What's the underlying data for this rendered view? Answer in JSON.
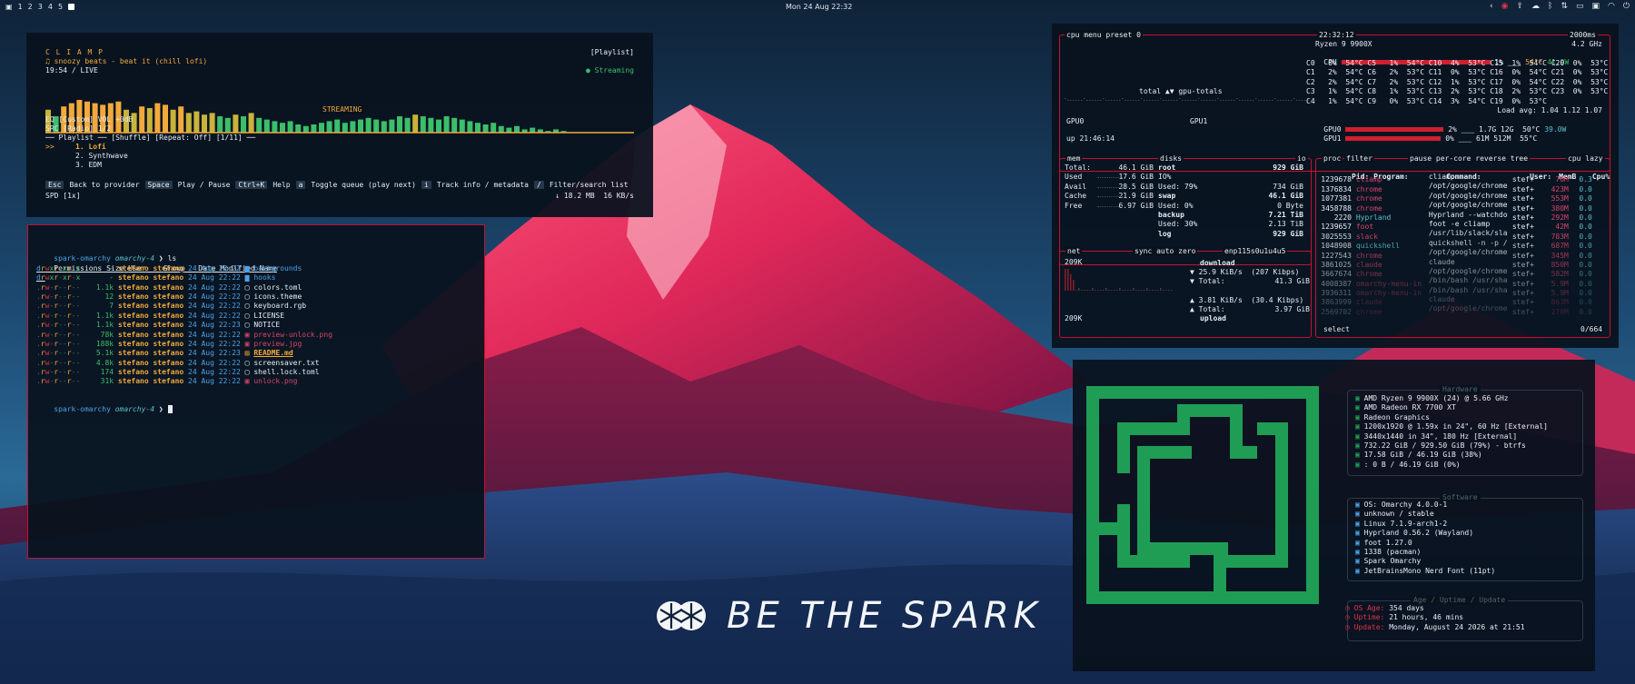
{
  "topbar": {
    "workspaces": [
      "1",
      "2",
      "3",
      "4",
      "5"
    ],
    "clock": "Mon 24 Aug 22:32"
  },
  "colors": {
    "accent": "#c41230",
    "bg": "#08121e"
  },
  "brand": {
    "text": "BE THE SPARK"
  },
  "cliamp": {
    "logo": "C L I A M P",
    "view": "[Playlist]",
    "track": "♫ snoozy beats - beat it (chill lofi)",
    "time": "19:54 / LIVE",
    "status": "● Streaming",
    "streaming_label": "STREAMING",
    "eq": "EQ [Custom] VOL +0dB",
    "src": "SRC [Radio] 1/2",
    "playlist_header": "── Playlist ── [Shuffle] [Repeat: Off] [1/11] ──",
    "playlist": [
      "1. Lofi",
      "2. Synthwave",
      "3. EDM"
    ],
    "cursor": ">>",
    "shortcuts": [
      {
        "key": "Esc",
        "label": "Back to provider"
      },
      {
        "key": "Space",
        "label": "Play / Pause"
      },
      {
        "key": "Ctrl+K",
        "label": "Help"
      },
      {
        "key": "a",
        "label": "Toggle queue (play next)"
      },
      {
        "key": "i",
        "label": "Track info / metadata"
      },
      {
        "key": "/",
        "label": "Filter/search list"
      }
    ],
    "speed": "SPD [1x]",
    "network": "↓ 18.2 MB  16 KB/s",
    "spectrum": [
      0.7,
      0.5,
      0.8,
      0.9,
      1.0,
      0.95,
      0.9,
      0.85,
      0.9,
      0.95,
      0.7,
      0.6,
      0.8,
      0.75,
      0.9,
      0.85,
      0.7,
      0.8,
      0.6,
      0.65,
      0.55,
      0.6,
      0.5,
      0.45,
      0.55,
      0.5,
      0.6,
      0.45,
      0.4,
      0.35,
      0.3,
      0.35,
      0.25,
      0.2,
      0.25,
      0.3,
      0.35,
      0.4,
      0.3,
      0.35,
      0.4,
      0.45,
      0.4,
      0.35,
      0.4,
      0.5,
      0.45,
      0.55,
      0.5,
      0.45,
      0.4,
      0.5,
      0.45,
      0.4,
      0.35,
      0.3,
      0.25,
      0.3,
      0.2,
      0.15,
      0.2,
      0.1,
      0.15,
      0.1,
      0.05,
      0.1,
      0.05
    ]
  },
  "terminal": {
    "prompt_host": "spark-omarchy",
    "prompt_dir": "omarchy-4",
    "command": "ls",
    "headers": [
      "Permissions",
      "Size",
      "User",
      "Group",
      "Date Modified",
      "Name"
    ],
    "rows": [
      {
        "perm": "drwxr-xr-x",
        "size": "-",
        "user": "stefano",
        "group": "stefano",
        "date": "24 Aug 22:22",
        "name": "backgrounds",
        "kind": "dir"
      },
      {
        "perm": "drwxr-xr-x",
        "size": "-",
        "user": "stefano",
        "group": "stefano",
        "date": "24 Aug 22:22",
        "name": "hooks",
        "kind": "dir"
      },
      {
        "perm": ".rw-r--r--",
        "size": "1.1k",
        "user": "stefano",
        "group": "stefano",
        "date": "24 Aug 22:22",
        "name": "colors.toml",
        "kind": "file"
      },
      {
        "perm": ".rw-r--r--",
        "size": "12",
        "user": "stefano",
        "group": "stefano",
        "date": "24 Aug 22:22",
        "name": "icons.theme",
        "kind": "file"
      },
      {
        "perm": ".rw-r--r--",
        "size": "7",
        "user": "stefano",
        "group": "stefano",
        "date": "24 Aug 22:22",
        "name": "keyboard.rgb",
        "kind": "file"
      },
      {
        "perm": ".rw-r--r--",
        "size": "1.1k",
        "user": "stefano",
        "group": "stefano",
        "date": "24 Aug 22:22",
        "name": "LICENSE",
        "kind": "file"
      },
      {
        "perm": ".rw-r--r--",
        "size": "1.1k",
        "user": "stefano",
        "group": "stefano",
        "date": "24 Aug 22:23",
        "name": "NOTICE",
        "kind": "file"
      },
      {
        "perm": ".rw-r--r--",
        "size": "78k",
        "user": "stefano",
        "group": "stefano",
        "date": "24 Aug 22:22",
        "name": "preview-unlock.png",
        "kind": "img"
      },
      {
        "perm": ".rw-r--r--",
        "size": "188k",
        "user": "stefano",
        "group": "stefano",
        "date": "24 Aug 22:22",
        "name": "preview.jpg",
        "kind": "img"
      },
      {
        "perm": ".rw-r--r--",
        "size": "5.1k",
        "user": "stefano",
        "group": "stefano",
        "date": "24 Aug 22:23",
        "name": "README.md",
        "kind": "md"
      },
      {
        "perm": ".rw-r--r--",
        "size": "4.8k",
        "user": "stefano",
        "group": "stefano",
        "date": "24 Aug 22:22",
        "name": "screensaver.txt",
        "kind": "file"
      },
      {
        "perm": ".rw-r--r--",
        "size": "174",
        "user": "stefano",
        "group": "stefano",
        "date": "24 Aug 22:22",
        "name": "shell.lock.toml",
        "kind": "file"
      },
      {
        "perm": ".rw-r--r--",
        "size": "31k",
        "user": "stefano",
        "group": "stefano",
        "date": "24 Aug 22:22",
        "name": "unlock.png",
        "kind": "img"
      }
    ]
  },
  "btop": {
    "header": {
      "cpu": "cpu",
      "menu": "menu",
      "preset": "preset 0",
      "time": "22:32:12",
      "interval": "2000ms"
    },
    "cpu_name": "Ryzen 9 9900X",
    "cpu_freq": "4.2 GHz",
    "cpu_total": {
      "label": "CPU",
      "pct": "1%",
      "temp": "54°C",
      "watt": "41.9W",
      "fill": 0.82
    },
    "cores": [
      "C0   0%  54°C C5   1%  54°C C10  4%  53°C C15  1%  54°C C20  0%  53°C",
      "C1   2%  54°C C6   2%  53°C C11  0%  53°C C16  0%  54°C C21  0%  53°C",
      "C2   2%  54°C C7   2%  53°C C12  1%  53°C C17  0%  54°C C22  0%  53°C",
      "C3   1%  54°C C8   1%  53°C C13  2%  53°C C18  2%  53°C C23  0%  53°C",
      "C4   1%  54°C C9   0%  53°C C14  3%  54°C C19  0%  53°C"
    ],
    "load_avg": "Load avg: 1.04 1.12 1.07",
    "gpu0": {
      "label": "GPU0",
      "pct": "2%",
      "extra": "1.7G 12G",
      "temp": "50°C",
      "watt": "39.0W",
      "fill": 0.72
    },
    "gpu1": {
      "label": "GPU1",
      "pct": "0%",
      "extra": "61M 512M",
      "temp": "55°C",
      "fill": 0.7
    },
    "graph_label": "total ▲▼ gpu-totals",
    "gpu_labels": [
      "GPU0",
      "GPU1"
    ],
    "uptime": "up 21:46:14",
    "mem": {
      "title": "mem",
      "rows": [
        {
          "k": "Total:",
          "v": "46.1 GiB"
        },
        {
          "k": "Used",
          "v": "17.6 GiB"
        },
        {
          "k": "Avail",
          "v": "28.5 GiB"
        },
        {
          "k": "Cache",
          "v": "21.9 GiB"
        },
        {
          "k": "Free",
          "v": "6.97 GiB"
        }
      ]
    },
    "disks": {
      "title": "disks",
      "io": "io",
      "rows": [
        {
          "k": "root",
          "v": "929 GiB"
        },
        {
          "k": "IO%",
          "v": ""
        },
        {
          "k": "Used: 79%",
          "v": "734 GiB"
        },
        {
          "k": "swap",
          "v": "46.1 GiB"
        },
        {
          "k": "Used: 0%",
          "v": "0 Byte"
        },
        {
          "k": "backup",
          "v": "7.21 TiB"
        },
        {
          "k": "Used: 30%",
          "v": "2.13 TiB"
        },
        {
          "k": "log",
          "v": "929 GiB"
        }
      ]
    },
    "net": {
      "title": "net",
      "tabs": "sync auto zero",
      "iface": "enp115s0u1u4u5",
      "scale_top": "209K",
      "scale_bottom": "209K",
      "download": "download",
      "dl_rate": "▼ 25.9 KiB/s  (207 Kibps)",
      "dl_total": "▼ Total:",
      "dl_total_v": "41.3 GiB",
      "ul_rate": "▲ 3.81 KiB/s  (30.4 Kibps)",
      "ul_total": "▲ Total:",
      "ul_total_v": "3.97 GiB",
      "upload": "upload"
    },
    "proc": {
      "title": "proc",
      "filter": "filter",
      "tabs": "pause per-core reverse tree",
      "sort": "cpu lazy",
      "headers": [
        "Pid:",
        "Program:",
        "Command:",
        "User:",
        "MemB",
        "Cpu%"
      ],
      "rows": [
        {
          "pid": "1239678",
          "prog": "cliamp",
          "cmd": "cliamp",
          "user": "stef+",
          "mem": "76M",
          "cpu": "0.3"
        },
        {
          "pid": "1376834",
          "prog": "chrome",
          "cmd": "/opt/google/chrome",
          "user": "stef+",
          "mem": "423M",
          "cpu": "0.0"
        },
        {
          "pid": "1077381",
          "prog": "chrome",
          "cmd": "/opt/google/chrome",
          "user": "stef+",
          "mem": "553M",
          "cpu": "0.0"
        },
        {
          "pid": "3458788",
          "prog": "chrome",
          "cmd": "/opt/google/chrome",
          "user": "stef+",
          "mem": "380M",
          "cpu": "0.0"
        },
        {
          "pid": "2220",
          "prog": "Hyprland",
          "cmd": "Hyprland --watchdo",
          "user": "stef+",
          "mem": "292M",
          "cpu": "0.0"
        },
        {
          "pid": "1239657",
          "prog": "foot",
          "cmd": "foot -e cliamp",
          "user": "stef+",
          "mem": "42M",
          "cpu": "0.0"
        },
        {
          "pid": "3025553",
          "prog": "slack",
          "cmd": "/usr/lib/slack/sla",
          "user": "stef+",
          "mem": "783M",
          "cpu": "0.0"
        },
        {
          "pid": "1048908",
          "prog": "quickshell",
          "cmd": "quickshell -n -p /",
          "user": "stef+",
          "mem": "687M",
          "cpu": "0.0"
        },
        {
          "pid": "1227543",
          "prog": "chrome",
          "cmd": "/opt/google/chrome",
          "user": "stef+",
          "mem": "345M",
          "cpu": "0.0"
        },
        {
          "pid": "3861025",
          "prog": "claude",
          "cmd": "claude",
          "user": "stef+",
          "mem": "850M",
          "cpu": "0.0"
        },
        {
          "pid": "3667674",
          "prog": "chrome",
          "cmd": "/opt/google/chrome",
          "user": "stef+",
          "mem": "582M",
          "cpu": "0.0"
        },
        {
          "pid": "4008387",
          "prog": "omarchy-menu-in",
          "cmd": "/bin/bash /usr/sha",
          "user": "stef+",
          "mem": "5.9M",
          "cpu": "0.0"
        },
        {
          "pid": "3936311",
          "prog": "omarchy-menu-in",
          "cmd": "/bin/bash /usr/sha",
          "user": "stef+",
          "mem": "5.9M",
          "cpu": "0.0"
        },
        {
          "pid": "3863999",
          "prog": "claude",
          "cmd": "claude",
          "user": "stef+",
          "mem": "863M",
          "cpu": "0.0"
        },
        {
          "pid": "2569702",
          "prog": "chrome",
          "cmd": "/opt/google/chrome",
          "user": "stef+",
          "mem": "270M",
          "cpu": "0.0"
        }
      ],
      "footer_left": "select",
      "footer_right": "0/664"
    }
  },
  "fastfetch": {
    "hardware_title": "Hardware",
    "hardware": [
      "AMD Ryzen 9 9900X (24) @ 5.66 GHz",
      "AMD Radeon RX 7700 XT",
      "Radeon Graphics",
      "1200x1920 @ 1.59x in 24\", 60 Hz [External]",
      "3440x1440 in 34\", 180 Hz [External]",
      "732.22 GiB / 929.50 GiB (79%) - btrfs",
      "17.58 GiB / 46.19 GiB (38%)",
      ": 0 B / 46.19 GiB (0%)"
    ],
    "software_title": "Software",
    "software": [
      "OS: Omarchy 4.0.0-1",
      "unknown / stable",
      "Linux 7.1.9-arch1-2",
      "Hyprland 0.56.2 (Wayland)",
      "foot 1.27.0",
      "1338 (pacman)",
      "Spark Omarchy",
      "JetBrainsMono Nerd Font (11pt)"
    ],
    "uptime_title": "Age / Uptime / Update",
    "uptime_rows": [
      {
        "k": "OS Age:",
        "v": "354 days"
      },
      {
        "k": "Uptime:",
        "v": "21 hours, 46 mins"
      },
      {
        "k": "Update:",
        "v": "Monday, August 24 2026 at 21:51"
      }
    ]
  }
}
